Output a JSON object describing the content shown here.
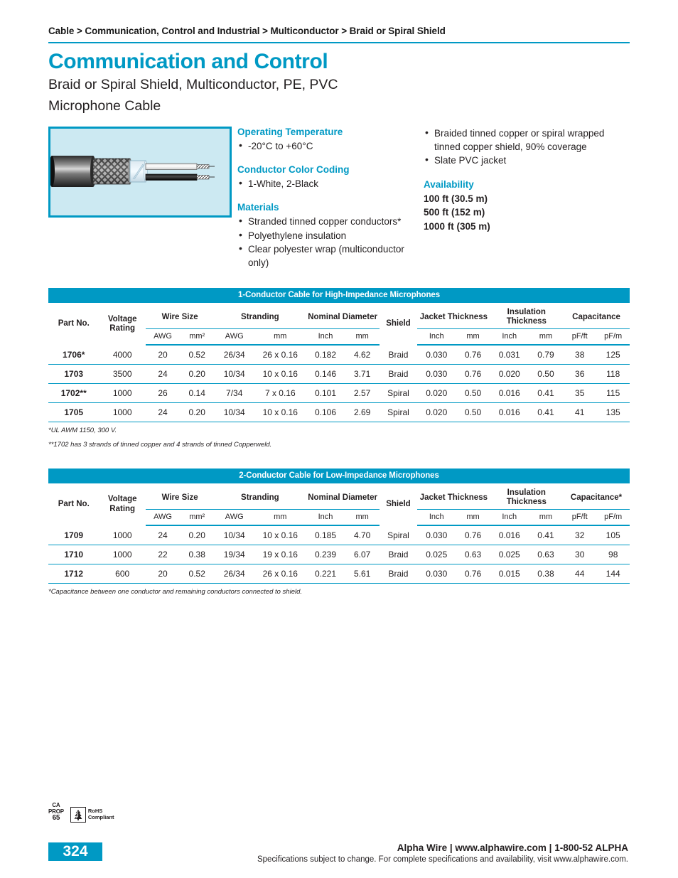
{
  "breadcrumb": "Cable > Communication, Control and Industrial > Multiconductor > Braid or Spiral Shield",
  "title": {
    "main": "Communication and Control",
    "sub_line1": "Braid or Spiral Shield, Multiconductor, PE, PVC",
    "sub_line2": "Microphone Cable"
  },
  "specs": {
    "operating_temperature": {
      "heading": "Operating Temperature",
      "items": [
        "-20°C to +60°C"
      ]
    },
    "color_coding": {
      "heading": "Conductor Color Coding",
      "items": [
        "1-White, 2-Black"
      ]
    },
    "materials": {
      "heading": "Materials",
      "items": [
        "Stranded tinned copper conductors*",
        "Polyethylene insulation",
        "Clear polyester wrap (multiconductor only)"
      ]
    },
    "construction": {
      "items": [
        "Braided tinned copper or spiral wrapped tinned copper shield, 90% coverage",
        "Slate PVC jacket"
      ]
    },
    "availability": {
      "heading": "Availability",
      "lines": [
        "100 ft (30.5 m)",
        "500 ft (152 m)",
        "1000 ft (305 m)"
      ]
    }
  },
  "table1": {
    "title": "1-Conductor Cable for High-Impedance Microphones",
    "headers": {
      "part_no": "Part No.",
      "voltage_rating": "Voltage Rating",
      "wire_size": "Wire Size",
      "stranding": "Stranding",
      "nominal_diameter": "Nominal Diameter",
      "shield": "Shield",
      "jacket_thickness": "Jacket Thickness",
      "insulation_thickness": "Insulation Thickness",
      "capacitance": "Capacitance"
    },
    "units": {
      "wire_awg": "AWG",
      "wire_mm2": "mm²",
      "strand_awg": "AWG",
      "strand_mm": "mm",
      "diam_inch": "Inch",
      "diam_mm": "mm",
      "jacket_inch": "Inch",
      "jacket_mm": "mm",
      "insul_inch": "Inch",
      "insul_mm": "mm",
      "cap_pfft": "pF/ft",
      "cap_pfm": "pF/m"
    },
    "rows": [
      {
        "part": "1706*",
        "voltage": "4000",
        "wire_awg": "20",
        "wire_mm2": "0.52",
        "strand_awg": "26/34",
        "strand_mm": "26 x 0.16",
        "diam_inch": "0.182",
        "diam_mm": "4.62",
        "shield": "Braid",
        "jacket_inch": "0.030",
        "jacket_mm": "0.76",
        "insul_inch": "0.031",
        "insul_mm": "0.79",
        "cap_pfft": "38",
        "cap_pfm": "125"
      },
      {
        "part": "1703",
        "voltage": "3500",
        "wire_awg": "24",
        "wire_mm2": "0.20",
        "strand_awg": "10/34",
        "strand_mm": "10 x 0.16",
        "diam_inch": "0.146",
        "diam_mm": "3.71",
        "shield": "Braid",
        "jacket_inch": "0.030",
        "jacket_mm": "0.76",
        "insul_inch": "0.020",
        "insul_mm": "0.50",
        "cap_pfft": "36",
        "cap_pfm": "118"
      },
      {
        "part": "1702**",
        "voltage": "1000",
        "wire_awg": "26",
        "wire_mm2": "0.14",
        "strand_awg": "7/34",
        "strand_mm": "7 x 0.16",
        "diam_inch": "0.101",
        "diam_mm": "2.57",
        "shield": "Spiral",
        "jacket_inch": "0.020",
        "jacket_mm": "0.50",
        "insul_inch": "0.016",
        "insul_mm": "0.41",
        "cap_pfft": "35",
        "cap_pfm": "115"
      },
      {
        "part": "1705",
        "voltage": "1000",
        "wire_awg": "24",
        "wire_mm2": "0.20",
        "strand_awg": "10/34",
        "strand_mm": "10 x 0.16",
        "diam_inch": "0.106",
        "diam_mm": "2.69",
        "shield": "Spiral",
        "jacket_inch": "0.020",
        "jacket_mm": "0.50",
        "insul_inch": "0.016",
        "insul_mm": "0.41",
        "cap_pfft": "41",
        "cap_pfm": "135"
      }
    ],
    "notes": [
      "*UL AWM 1150, 300 V.",
      "**1702 has 3 strands of tinned copper and 4 strands of tinned Copperweld."
    ]
  },
  "table2": {
    "title": "2-Conductor Cable for Low-Impedance Microphones",
    "headers": {
      "part_no": "Part No.",
      "voltage_rating": "Voltage Rating",
      "wire_size": "Wire Size",
      "stranding": "Stranding",
      "nominal_diameter": "Nominal Diameter",
      "shield": "Shield",
      "jacket_thickness": "Jacket Thickness",
      "insulation_thickness": "Insulation Thickness",
      "capacitance": "Capacitance*"
    },
    "units": {
      "wire_awg": "AWG",
      "wire_mm2": "mm²",
      "strand_awg": "AWG",
      "strand_mm": "mm",
      "diam_inch": "Inch",
      "diam_mm": "mm",
      "jacket_inch": "Inch",
      "jacket_mm": "mm",
      "insul_inch": "Inch",
      "insul_mm": "mm",
      "cap_pfft": "pF/ft",
      "cap_pfm": "pF/m"
    },
    "rows": [
      {
        "part": "1709",
        "voltage": "1000",
        "wire_awg": "24",
        "wire_mm2": "0.20",
        "strand_awg": "10/34",
        "strand_mm": "10 x 0.16",
        "diam_inch": "0.185",
        "diam_mm": "4.70",
        "shield": "Spiral",
        "jacket_inch": "0.030",
        "jacket_mm": "0.76",
        "insul_inch": "0.016",
        "insul_mm": "0.41",
        "cap_pfft": "32",
        "cap_pfm": "105"
      },
      {
        "part": "1710",
        "voltage": "1000",
        "wire_awg": "22",
        "wire_mm2": "0.38",
        "strand_awg": "19/34",
        "strand_mm": "19 x 0.16",
        "diam_inch": "0.239",
        "diam_mm": "6.07",
        "shield": "Braid",
        "jacket_inch": "0.025",
        "jacket_mm": "0.63",
        "insul_inch": "0.025",
        "insul_mm": "0.63",
        "cap_pfft": "30",
        "cap_pfm": "98"
      },
      {
        "part": "1712",
        "voltage": "600",
        "wire_awg": "20",
        "wire_mm2": "0.52",
        "strand_awg": "26/34",
        "strand_mm": "26 x 0.16",
        "diam_inch": "0.221",
        "diam_mm": "5.61",
        "shield": "Braid",
        "jacket_inch": "0.030",
        "jacket_mm": "0.76",
        "insul_inch": "0.015",
        "insul_mm": "0.38",
        "cap_pfft": "44",
        "cap_pfm": "144"
      }
    ],
    "notes": [
      "*Capacitance between one conductor and remaining conductors connected to shield."
    ]
  },
  "certifications": {
    "ca_prop_line1": "CA",
    "ca_prop_line2": "PROP",
    "ca_prop_line3": "65",
    "rohs_line1": "RoHS",
    "rohs_line2": "Compliant"
  },
  "footer": {
    "page_number": "324",
    "contact": "Alpha Wire | www.alphawire.com | 1-800-52 ALPHA",
    "disclaimer": "Specifications subject to change. For complete specifications and availability, visit www.alphawire.com."
  },
  "colors": {
    "accent": "#0099C4",
    "figure_background": "#CCE9F2",
    "text": "#231F20"
  }
}
